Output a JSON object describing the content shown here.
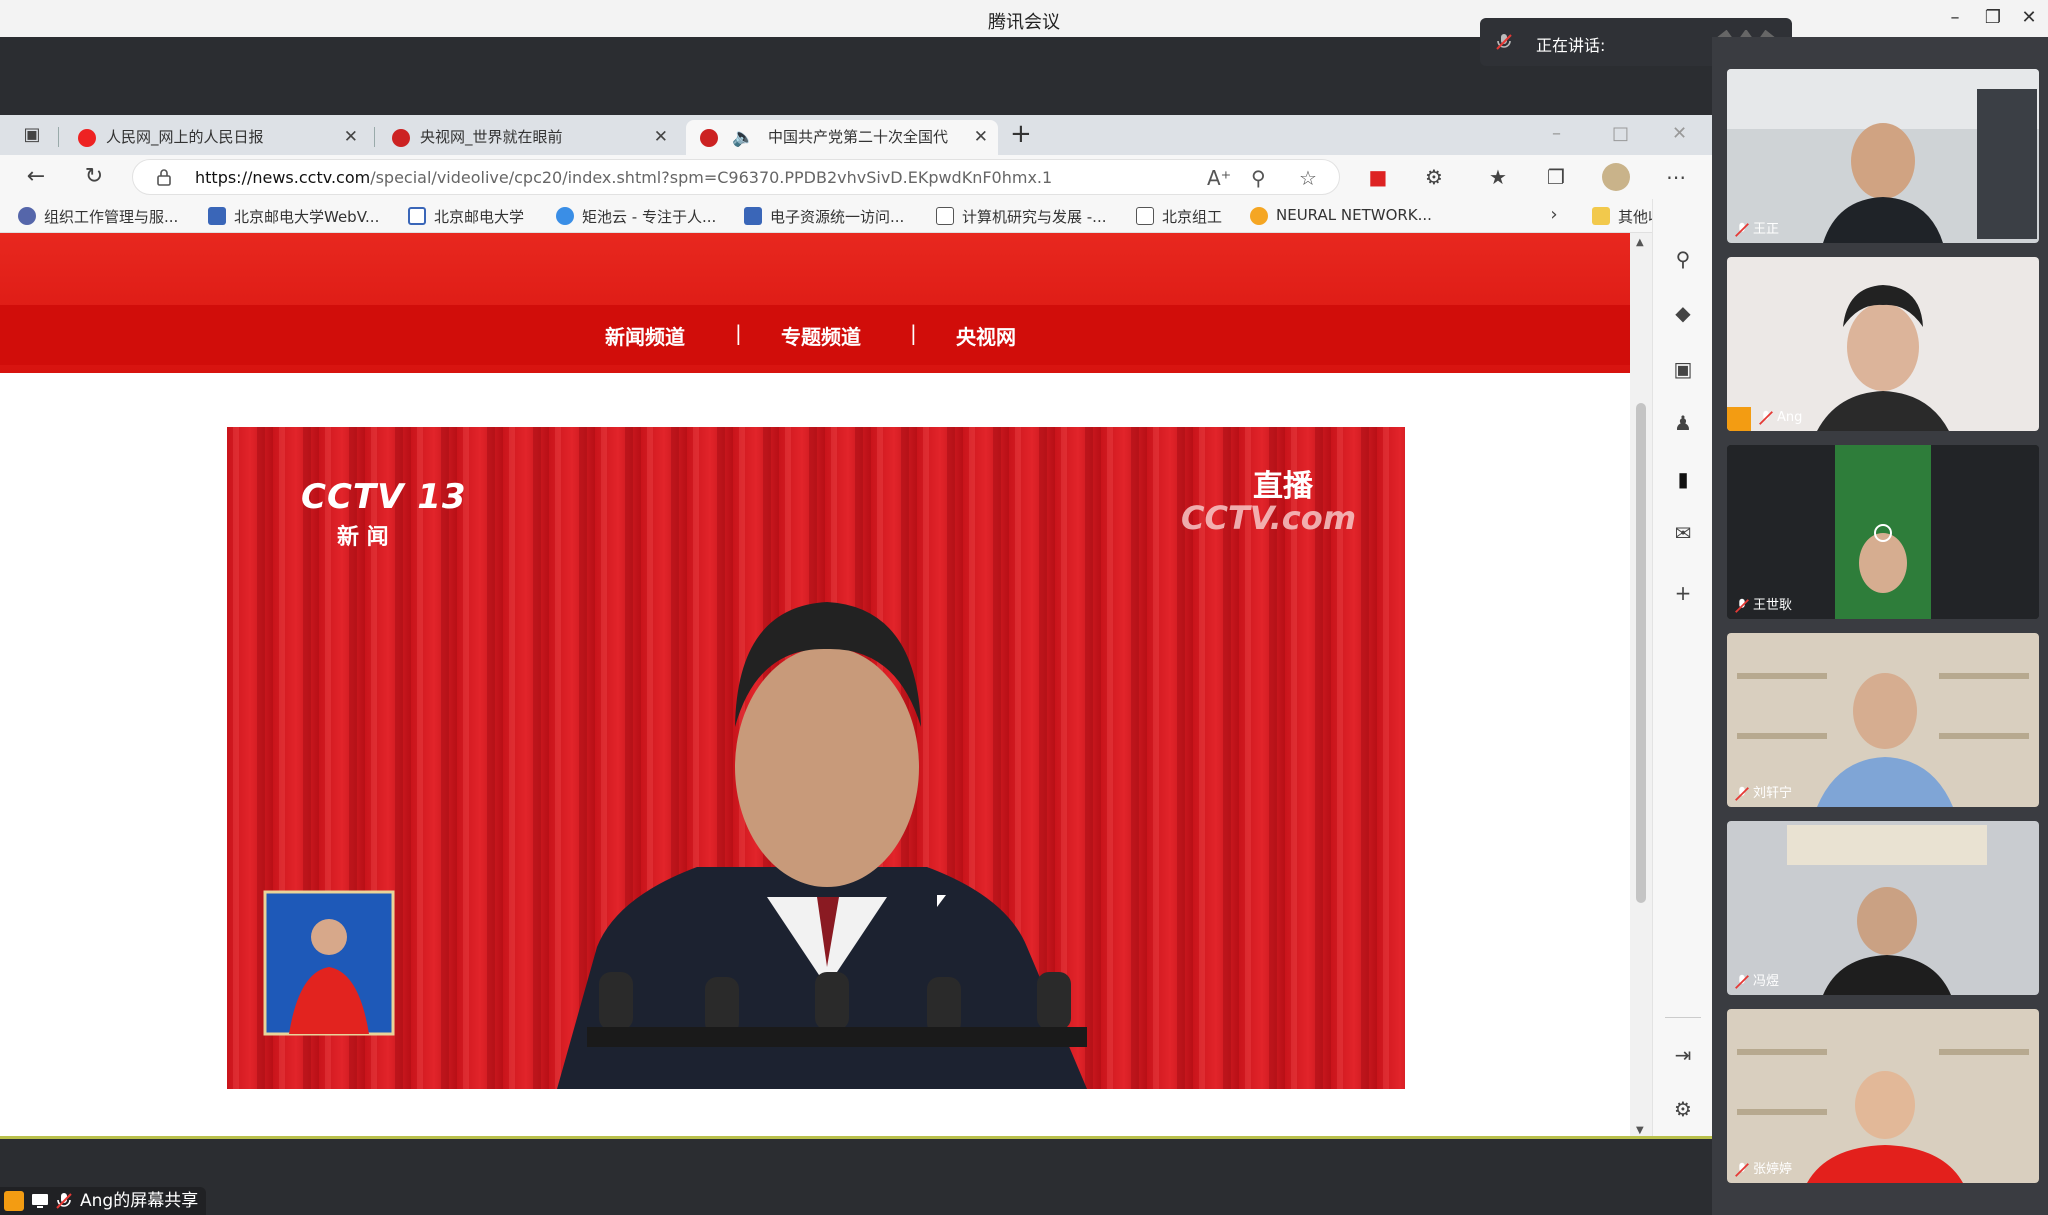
{
  "app": {
    "window_title": "腾讯会议",
    "speaking_label": "正在讲话:",
    "share_label": "Ang的屏幕共享"
  },
  "browser": {
    "tabs": [
      {
        "label": "人民网_网上的人民日报",
        "active": false
      },
      {
        "label": "央视网_世界就在眼前",
        "active": false
      },
      {
        "label": "中国共产党第二十次全国代",
        "active": true
      }
    ],
    "url_host": "https://news.cctv.com",
    "url_rest": "/special/videolive/cpc20/index.shtml?spm=C96370.PPDB2vhvSivD.EKpwdKnF0hmx.1",
    "bookmarks": [
      {
        "label": "组织工作管理与服...",
        "icon": "globe-icon"
      },
      {
        "label": "北京邮电大学WebV...",
        "icon": "web-icon"
      },
      {
        "label": "北京邮电大学",
        "icon": "bupt-icon"
      },
      {
        "label": "矩池云 - 专注于人...",
        "icon": "cloud-icon"
      },
      {
        "label": "电子资源统一访问...",
        "icon": "resource-icon"
      },
      {
        "label": "计算机研究与发展 -...",
        "icon": "page-icon"
      },
      {
        "label": "北京组工",
        "icon": "page-icon"
      },
      {
        "label": "NEURAL NETWORK...",
        "icon": "p-icon"
      },
      {
        "label": "其他收藏夹",
        "icon": "folder-icon"
      }
    ]
  },
  "page": {
    "nav": [
      "新闻频道",
      "专题频道",
      "央视网"
    ],
    "nav_sep": "|",
    "video": {
      "channel_logo": "CCTV 13",
      "channel_sub": "新 闻",
      "live_badge": "直播",
      "watermark": "CCTV.com"
    }
  },
  "participants": [
    {
      "name": "王正",
      "host": false
    },
    {
      "name": "Ang",
      "host": true
    },
    {
      "name": "王世耿",
      "host": false
    },
    {
      "name": "刘轩宁",
      "host": false
    },
    {
      "name": "冯煜",
      "host": false
    },
    {
      "name": "张婷婷",
      "host": false
    }
  ],
  "colors": {
    "page_red": "#d7130f",
    "meeting_bg": "#2b2d31",
    "host_badge": "#f39c12"
  }
}
